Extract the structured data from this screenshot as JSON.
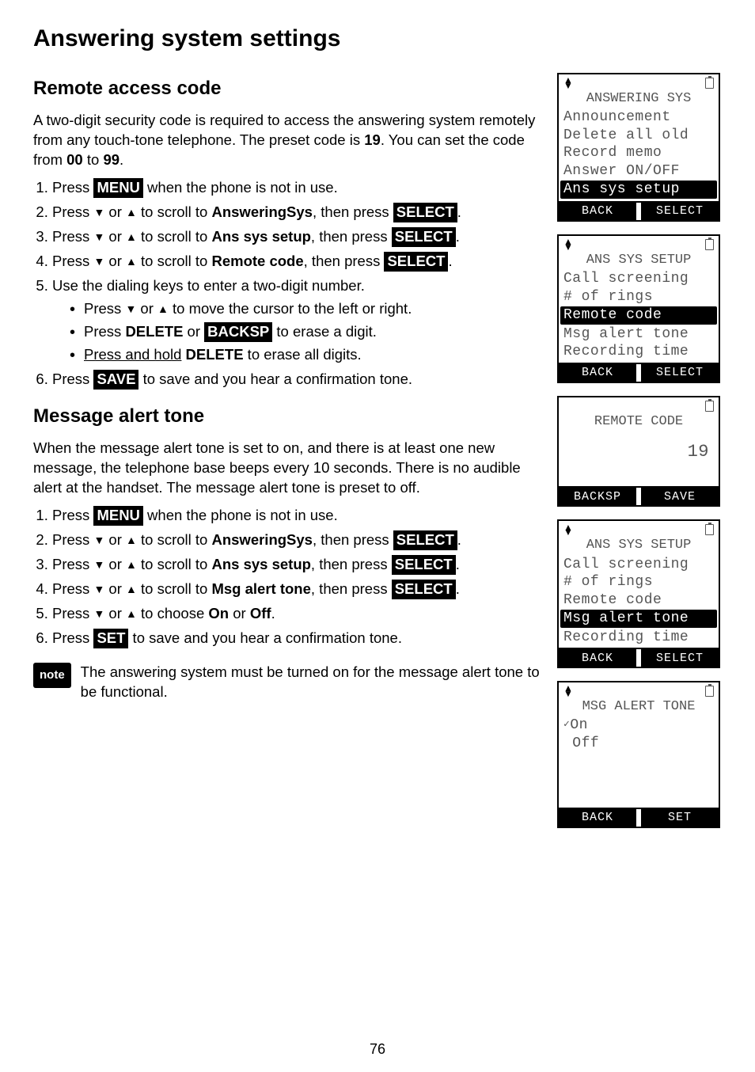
{
  "page": {
    "title": "Answering system settings",
    "number": "76"
  },
  "sec1": {
    "heading": "Remote access code",
    "intro_a": "A two-digit security code is required to access the answering system remotely from any touch-tone telephone. The preset code is ",
    "intro_b": "19",
    "intro_c": ". You can set the code from ",
    "intro_d": "00",
    "intro_e": " to ",
    "intro_f": "99",
    "intro_g": ".",
    "step1_a": "Press ",
    "step1_b": "MENU",
    "step1_c": " when the phone is not in use.",
    "step2_a": "Press ",
    "step2_b": " or ",
    "step2_c": " to scroll to ",
    "step2_d": "AnsweringSys",
    "step2_e": ", then press ",
    "step2_f": "SELECT",
    "step2_g": ".",
    "step3_d": "Ans sys setup",
    "step4_d": "Remote code",
    "step5": "Use the dialing keys to enter a two-digit number.",
    "step5_b1_a": "Press ",
    "step5_b1_b": " or ",
    "step5_b1_c": " to move the cursor to the left or right.",
    "step5_b2_a": "Press ",
    "step5_b2_b": "DELETE",
    "step5_b2_c": " or ",
    "step5_b2_d": "BACKSP",
    "step5_b2_e": " to erase a digit.",
    "step5_b3_a": "Press and hold",
    "step5_b3_b": " DELETE",
    "step5_b3_c": " to erase all digits.",
    "step6_a": "Press ",
    "step6_b": "SAVE",
    "step6_c": " to save and you hear a confirmation tone."
  },
  "sec2": {
    "heading": "Message alert tone",
    "intro": "When the message alert tone is set to on, and there is at least one new message, the telephone base beeps every 10 seconds. There is no audible alert at the handset. The message alert tone is preset to off.",
    "step4_d": "Msg alert tone",
    "step5_a": "Press ",
    "step5_b": " or ",
    "step5_c": " to choose ",
    "step5_d": "On",
    "step5_e": " or ",
    "step5_f": "Off",
    "step5_g": ".",
    "step6_a": "Press ",
    "step6_b": "SET",
    "step6_c": " to save and you hear a confirmation tone.",
    "note_label": "note",
    "note_text": "The answering system must be turned on for the message alert tone to be functional."
  },
  "screens": {
    "s1": {
      "title": "ANSWERING SYS",
      "l1": "Announcement",
      "l2": "Delete all old",
      "l3": "Record memo",
      "l4": "Answer ON/OFF",
      "hl": "Ans sys setup",
      "sk1": "BACK",
      "sk2": "SELECT"
    },
    "s2": {
      "title": "ANS SYS SETUP",
      "l1": "Call screening",
      "l2": "# of rings",
      "hl": "Remote code",
      "l3": "Msg alert tone",
      "l4": "Recording time",
      "sk1": "BACK",
      "sk2": "SELECT"
    },
    "s3": {
      "title": "REMOTE CODE",
      "value": "19",
      "sk1": "BACKSP",
      "sk2": "SAVE"
    },
    "s4": {
      "title": "ANS SYS SETUP",
      "l1": "Call screening",
      "l2": "# of rings",
      "l3": "Remote code",
      "hl": "Msg alert tone",
      "l4": "Recording time",
      "sk1": "BACK",
      "sk2": "SELECT"
    },
    "s5": {
      "title": "MSG ALERT TONE",
      "l1": "On",
      "l2": " Off",
      "sk1": "BACK",
      "sk2": "SET"
    }
  }
}
